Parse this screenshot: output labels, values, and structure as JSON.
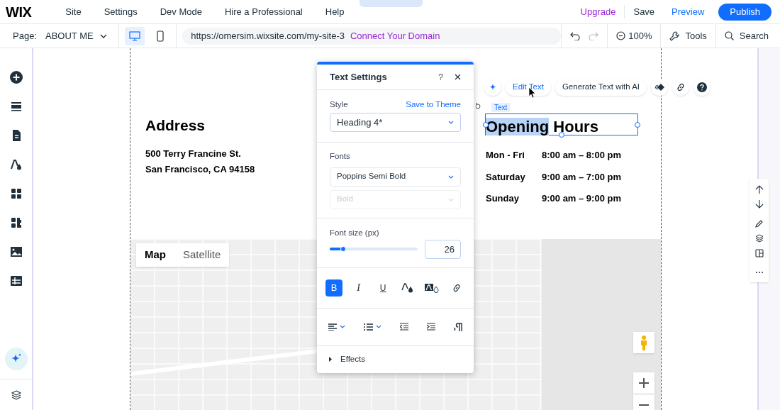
{
  "top_bar": {
    "logo": "WIX",
    "menu": [
      "Site",
      "Settings",
      "Dev Mode",
      "Hire a Professional",
      "Help"
    ],
    "upgrade": "Upgrade",
    "save": "Save",
    "preview": "Preview",
    "publish": "Publish"
  },
  "toolbar": {
    "page_label": "Page:",
    "page_value": "ABOUT ME",
    "devices": [
      {
        "kind": "desktop",
        "selected": true
      },
      {
        "kind": "mobile",
        "selected": false
      }
    ],
    "url": "https://omersim.wixsite.com/my-site-3",
    "connect_domain": "Connect Your Domain",
    "zoom": "100%",
    "tools": "Tools",
    "search": "Search"
  },
  "canvas": {
    "address_heading": "Address",
    "address_lines": [
      "500 Terry Francine St.",
      "San Francisco, CA 94158"
    ],
    "element_tag": "Text",
    "hours_heading": {
      "highlighted": "Opening",
      "rest": " Hours"
    },
    "hours": [
      {
        "day": "Mon - Fri",
        "time": "8:00 am – 8:00 pm"
      },
      {
        "day": "Saturday",
        "time": "9:00 am – 7:00 pm"
      },
      {
        "day": "Sunday",
        "time": "9:00 am – 9:00 pm"
      }
    ],
    "map_types": [
      {
        "label": "Map",
        "selected": true
      },
      {
        "label": "Satellite",
        "selected": false
      }
    ]
  },
  "element_toolbar": {
    "edit_text": "Edit Text",
    "generate": "Generate Text with AI"
  },
  "text_settings": {
    "title": "Text Settings",
    "help": "?",
    "style_label": "Style",
    "save_to_theme": "Save to Theme",
    "style_value": "Heading 4*",
    "fonts_label": "Fonts",
    "font_value": "Poppins Semi Bold",
    "weight_value": "Bold",
    "weight_disabled": true,
    "font_size_label": "Font size (px)",
    "font_size_slider": {
      "level": 0.15
    },
    "font_size_value": "26",
    "format_buttons": [
      {
        "kind": "bold",
        "label": "B",
        "selected": true
      },
      {
        "kind": "italic",
        "label": "I",
        "selected": false
      },
      {
        "kind": "underline",
        "label": "U",
        "selected": false
      },
      {
        "kind": "color",
        "selected": false
      },
      {
        "kind": "highlight",
        "selected": false
      },
      {
        "kind": "link",
        "selected": false
      }
    ],
    "effects": "Effects"
  }
}
